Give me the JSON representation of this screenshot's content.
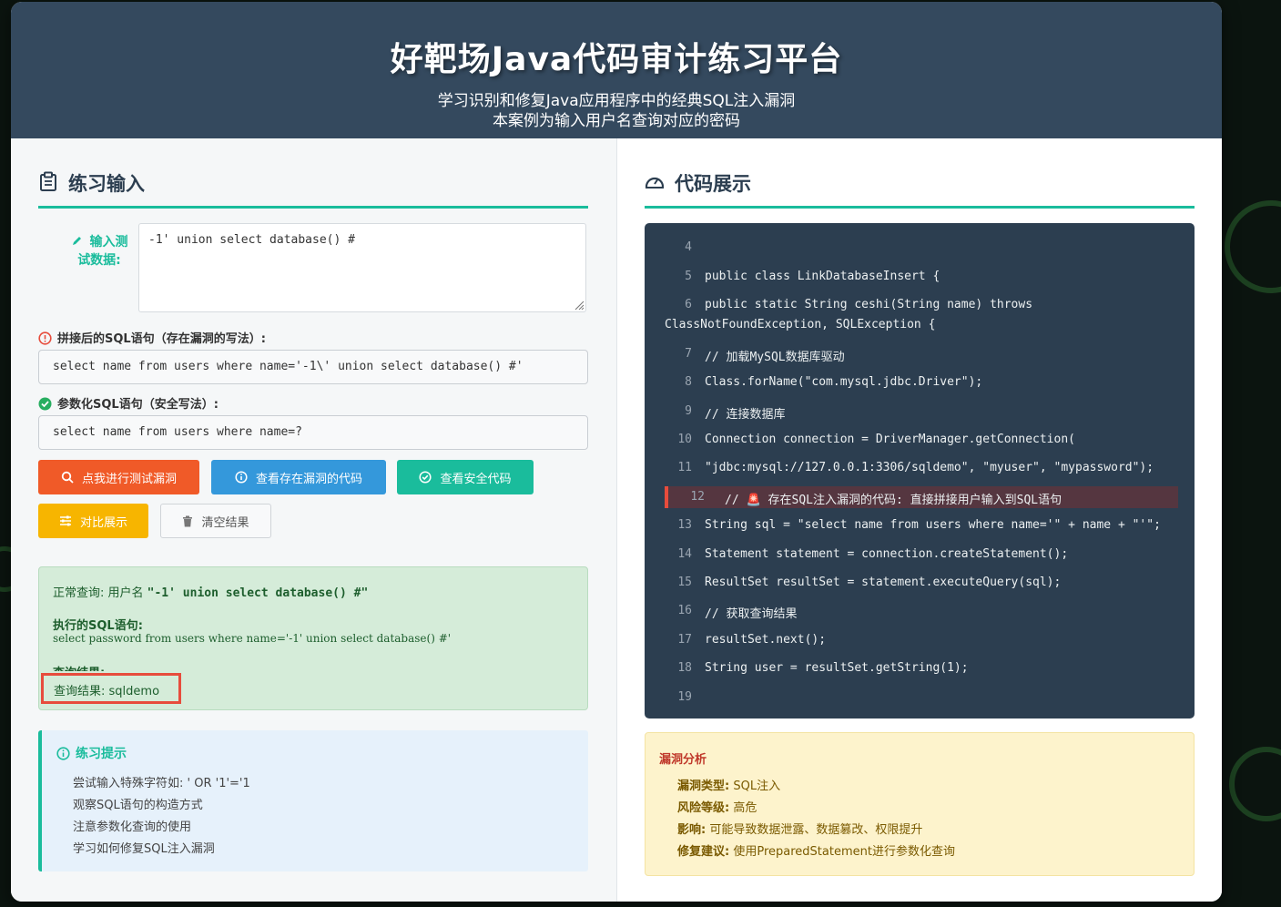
{
  "header": {
    "title": "好靶场Java代码审计练习平台",
    "subtitle_line1": "学习识别和修复Java应用程序中的经典SQL注入漏洞",
    "subtitle_line2": "本案例为输入用户名查询对应的密码"
  },
  "left": {
    "section_title": "练习输入",
    "input_label_line1": "输入测",
    "input_label_line2": "试数据:",
    "input_value": "-1' union select database() #",
    "concat_label": "拼接后的SQL语句（存在漏洞的写法）:",
    "concat_sql": "select name from users where name='-1\\' union select database() #'",
    "param_label": "参数化SQL语句（安全写法）:",
    "param_sql": "select name from users where name=?",
    "buttons": {
      "test": "点我进行测试漏洞",
      "vuln_code": "查看存在漏洞的代码",
      "safe_code": "查看安全代码",
      "compare": "对比展示",
      "clear": "清空结果"
    },
    "result": {
      "normal_prefix": "正常查询: 用户名 ",
      "normal_value": "\"-1' union select database() #\"",
      "exec_label": "执行的SQL语句:",
      "exec_sql": "select password from users where name='-1' union select database() #'",
      "query_label": "查询结果:",
      "query_result": "查询结果: sqldemo"
    },
    "tips": {
      "title": "练习提示",
      "items": [
        "尝试输入特殊字符如: ' OR '1'='1",
        "观察SQL语句的构造方式",
        "注意参数化查询的使用",
        "学习如何修复SQL注入漏洞"
      ]
    }
  },
  "right": {
    "section_title": "代码展示",
    "code_lines": [
      {
        "n": "4",
        "t": ""
      },
      {
        "n": "5",
        "t": "public class LinkDatabaseInsert {"
      },
      {
        "n": "6",
        "t": " public static String ceshi(String name) throws"
      },
      {
        "n": "",
        "t": "ClassNotFoundException, SQLException {"
      },
      {
        "n": "7",
        "t": " // 加载MySQL数据库驱动"
      },
      {
        "n": "8",
        "t": " Class.forName(\"com.mysql.jdbc.Driver\");"
      },
      {
        "n": "9",
        "t": " // 连接数据库"
      },
      {
        "n": "10",
        "t": " Connection connection = DriverManager.getConnection("
      },
      {
        "n": "11",
        "t": " \"jdbc:mysql://127.0.0.1:3306/sqldemo\", \"myuser\", \"mypassword\");"
      },
      {
        "n": "12",
        "t": " // 🚨 存在SQL注入漏洞的代码: 直接拼接用户输入到SQL语句"
      },
      {
        "n": "13",
        "t": " String sql = \"select name from users where name='\" + name + \"'\";"
      },
      {
        "n": "14",
        "t": " Statement statement = connection.createStatement();"
      },
      {
        "n": "15",
        "t": " ResultSet resultSet = statement.executeQuery(sql);"
      },
      {
        "n": "16",
        "t": " // 获取查询结果"
      },
      {
        "n": "17",
        "t": " resultSet.next();"
      },
      {
        "n": "18",
        "t": " String user = resultSet.getString(1);"
      },
      {
        "n": "19",
        "t": ""
      }
    ],
    "analysis": {
      "title": "漏洞分析",
      "items": [
        {
          "k": "漏洞类型:",
          "v": " SQL注入"
        },
        {
          "k": "风险等级:",
          "v": " 高危"
        },
        {
          "k": "影响:",
          "v": " 可能导致数据泄露、数据篡改、权限提升"
        },
        {
          "k": "修复建议:",
          "v": " 使用PreparedStatement进行参数化查询"
        }
      ]
    }
  },
  "colors": {
    "header_bg": "#34495e",
    "accent": "#1abc9c",
    "btn_red": "#f05a28",
    "btn_blue": "#3498db",
    "btn_teal": "#1abc9c",
    "btn_yellow": "#f7b500",
    "code_bg": "#2c3e50"
  }
}
